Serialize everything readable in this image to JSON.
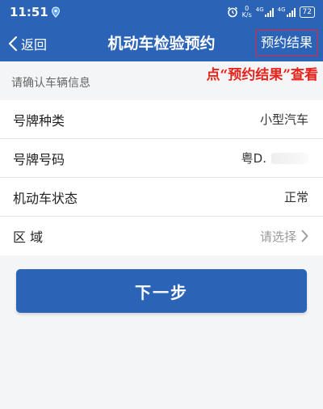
{
  "status_bar": {
    "time": "11:51",
    "speed_value": "0",
    "speed_unit": "K/s",
    "network1": "4G",
    "network2": "4G",
    "battery": "72"
  },
  "nav": {
    "back_label": "返回",
    "title": "机动车检验预约",
    "result_label": "预约结果"
  },
  "hint": "点“预约结果”查看",
  "section_header": "请确认车辆信息",
  "rows": [
    {
      "label": "号牌种类",
      "value": "小型汽车"
    },
    {
      "label": "号牌号码",
      "value": "粤D."
    },
    {
      "label": "机动车状态",
      "value": "正常"
    },
    {
      "label": "区 域",
      "value": "请选择"
    }
  ],
  "next_button": "下一步",
  "colors": {
    "primary": "#2b64b7",
    "hint": "#e8231b",
    "background": "#f4f5f7"
  },
  "icons": [
    "location-icon",
    "alarm-icon",
    "back-chevron-icon",
    "chevron-right-icon"
  ]
}
